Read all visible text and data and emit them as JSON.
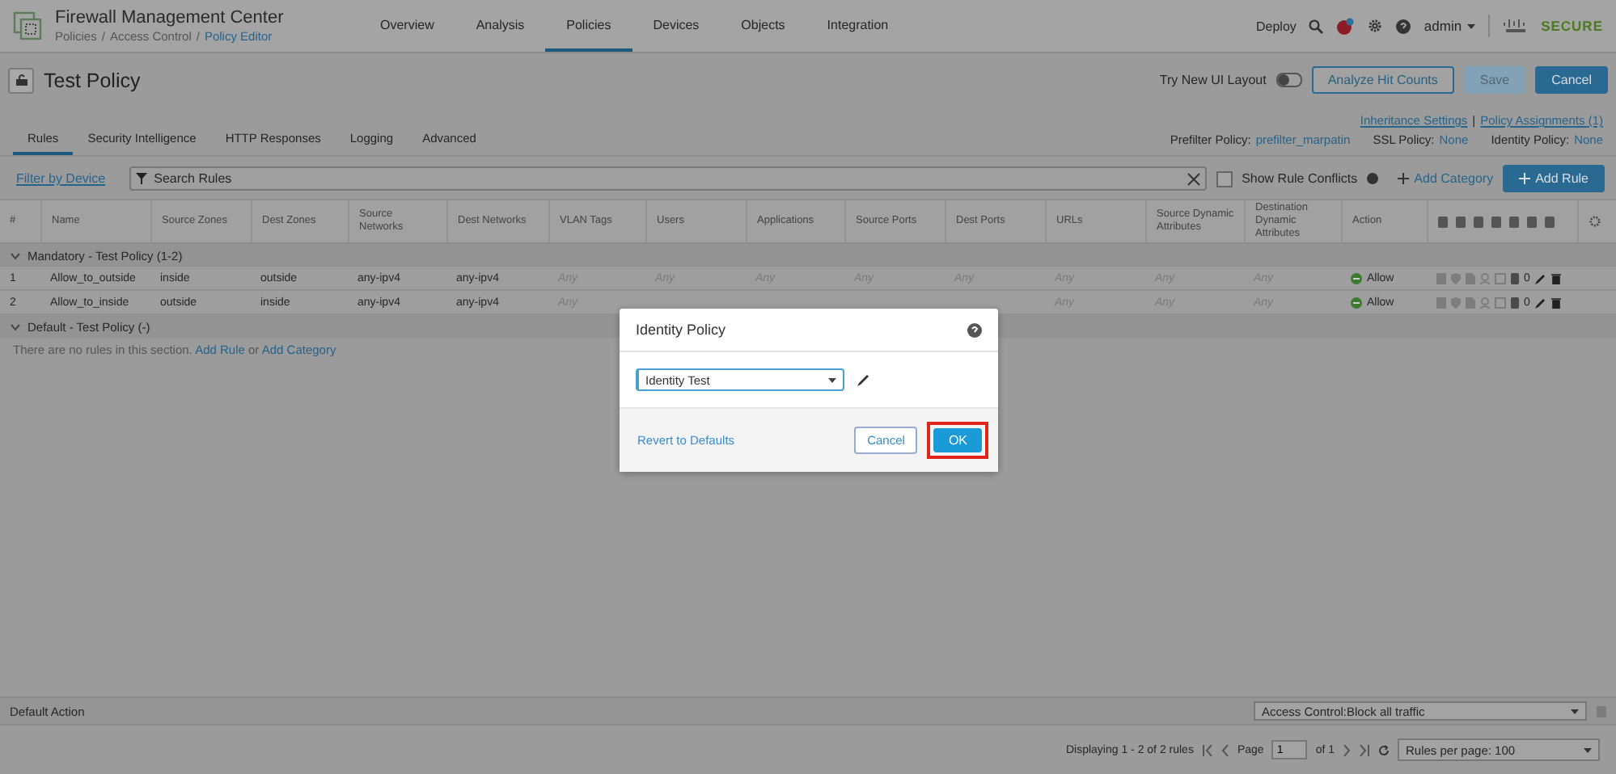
{
  "header": {
    "app_title": "Firewall Management Center",
    "breadcrumb": [
      {
        "label": "Policies",
        "link": false
      },
      {
        "label": "Access Control",
        "link": false
      },
      {
        "label": "Policy Editor",
        "link": true
      }
    ],
    "breadcrumb_separator": "/",
    "nav": [
      {
        "label": "Overview",
        "selected": false
      },
      {
        "label": "Analysis",
        "selected": false
      },
      {
        "label": "Policies",
        "selected": true
      },
      {
        "label": "Devices",
        "selected": false
      },
      {
        "label": "Objects",
        "selected": false
      },
      {
        "label": "Integration",
        "selected": false
      }
    ],
    "deploy": "Deploy",
    "user": "admin",
    "brand": "SECURE"
  },
  "policy": {
    "name": "Test Policy",
    "try_new_ui": "Try New UI Layout",
    "new_ui_on": false,
    "buttons": [
      {
        "label": "Analyze Hit Counts",
        "kind": "outline",
        "disabled": false
      },
      {
        "label": "Save",
        "kind": "primary",
        "disabled": true
      },
      {
        "label": "Cancel",
        "kind": "primary",
        "disabled": false
      }
    ]
  },
  "tabs": [
    {
      "label": "Rules",
      "selected": true
    },
    {
      "label": "Security Intelligence",
      "selected": false
    },
    {
      "label": "HTTP Responses",
      "selected": false
    },
    {
      "label": "Logging",
      "selected": false
    },
    {
      "label": "Advanced",
      "selected": false
    }
  ],
  "inheritance_links": [
    "Inheritance Settings",
    "Policy Assignments (1)"
  ],
  "links_separator": "|",
  "policy_refs": [
    {
      "label": "Prefilter Policy:",
      "value": "prefilter_marpatin"
    },
    {
      "label": "SSL Policy:",
      "value": "None"
    },
    {
      "label": "Identity Policy:",
      "value": "None"
    }
  ],
  "toolbar": {
    "filter_by_device": "Filter by Device",
    "search": {
      "placeholder": "Search Rules"
    },
    "show_conflicts": {
      "label": "Show Rule Conflicts",
      "checked": false
    },
    "add_category": "Add Category",
    "add_rule": "Add Rule"
  },
  "table": {
    "columns": [
      "#",
      "Name",
      "Source Zones",
      "Dest Zones",
      "Source Networks",
      "Dest Networks",
      "VLAN Tags",
      "Users",
      "Applications",
      "Source Ports",
      "Dest Ports",
      "URLs",
      "Source Dynamic Attributes",
      "Destination Dynamic Attributes",
      "Action"
    ],
    "sections": [
      {
        "title": "Mandatory - Test Policy (1-2)",
        "expanded": true,
        "rows": [
          {
            "number": "1",
            "cells": [
              "Allow_to_outside",
              "inside",
              "outside",
              "any-ipv4",
              "any-ipv4",
              "Any",
              "Any",
              "Any",
              "Any",
              "Any",
              "Any",
              "Any",
              "Any"
            ],
            "action": "Allow",
            "hits": "0"
          },
          {
            "number": "2",
            "cells": [
              "Allow_to_inside",
              "outside",
              "inside",
              "any-ipv4",
              "any-ipv4",
              "Any",
              null,
              null,
              null,
              null,
              "Any",
              "Any",
              "Any"
            ],
            "action": "Allow",
            "hits": "0"
          }
        ]
      },
      {
        "title": "Default - Test Policy (-)",
        "expanded": true,
        "empty_message": {
          "text": "There are no rules in this section.",
          "link1": "Add Rule",
          "joiner": "or",
          "link2": "Add Category"
        }
      }
    ]
  },
  "default_action": {
    "label": "Default Action",
    "value": "Access Control:Block all traffic"
  },
  "pagination": {
    "summary": "Displaying 1 - 2 of 2 rules",
    "page_label": "Page",
    "page": "1",
    "of": "of 1",
    "per_page": "Rules per page: 100"
  },
  "dialog": {
    "title": "Identity Policy",
    "selected": "Identity Test",
    "revert": "Revert to Defaults",
    "cancel": "Cancel",
    "ok": "OK"
  }
}
